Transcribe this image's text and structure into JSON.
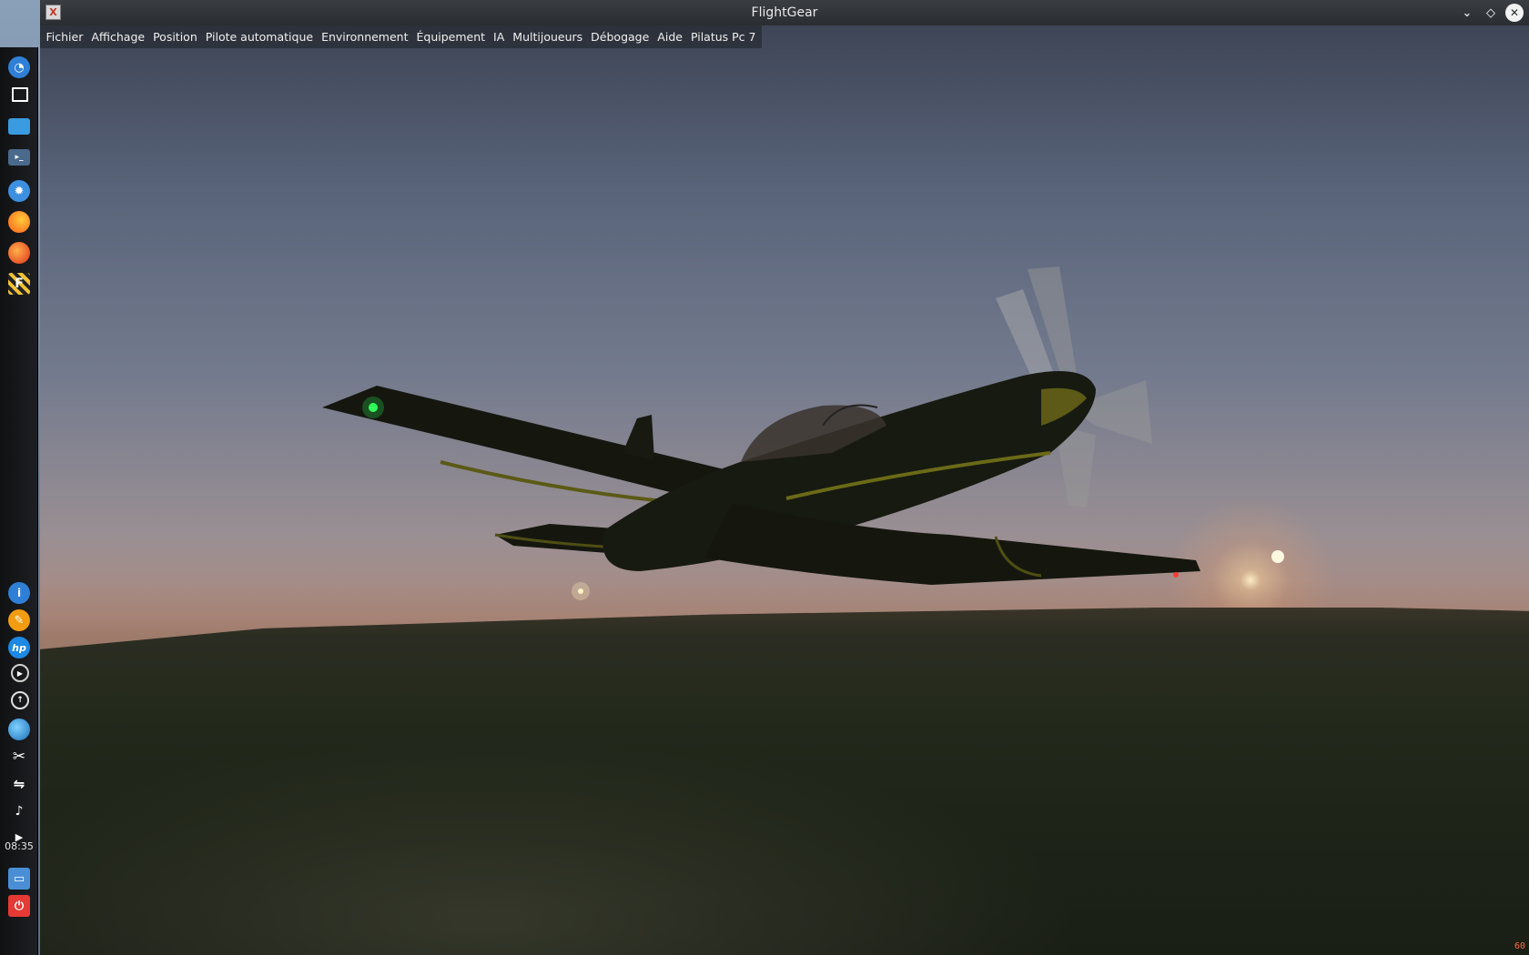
{
  "window": {
    "title": "FlightGear"
  },
  "menu": {
    "items": [
      "Fichier",
      "Affichage",
      "Position",
      "Pilote automatique",
      "Environnement",
      "Équipement",
      "IA",
      "Multijoueurs",
      "Débogage",
      "Aide",
      "Pilatus Pc 7"
    ]
  },
  "taskbar": {
    "clock": "08:35",
    "launchers": [
      {
        "icon": "kde-launcher-icon",
        "color": "#2f7fd6"
      },
      {
        "icon": "desktop-icon",
        "color": "#ffffff"
      },
      {
        "icon": "file-manager-icon",
        "color": "#3a9be0"
      },
      {
        "icon": "terminal-icon",
        "color": "#4a6a8c"
      },
      {
        "icon": "settings-icon",
        "color": "#3d8fe0"
      },
      {
        "icon": "firefox-icon",
        "color": "#ff7a1a"
      },
      {
        "icon": "firefox-alt-icon",
        "color": "#ff5a2a"
      },
      {
        "icon": "flightgear-icon",
        "color": "#f1c232"
      }
    ],
    "tray": [
      {
        "icon": "info-icon",
        "color": "#2f7fd6"
      },
      {
        "icon": "color-picker-icon",
        "color": "#f39c12"
      },
      {
        "icon": "hp-icon",
        "color": "#1e88e5"
      },
      {
        "icon": "media-player-icon",
        "color": "#d0d0d0"
      },
      {
        "icon": "updates-icon",
        "color": "#e0e0e0"
      },
      {
        "icon": "network-globe-icon",
        "color": "#3fa7e0"
      },
      {
        "icon": "scissors-icon",
        "color": "#e0e0e0"
      },
      {
        "icon": "usb-icon",
        "color": "#e0e0e0"
      },
      {
        "icon": "volume-icon",
        "color": "#e0e0e0"
      },
      {
        "icon": "expand-arrow-icon",
        "color": "#e0e0e0"
      },
      {
        "icon": "lock-screen-icon",
        "color": "#4a8fd6"
      },
      {
        "icon": "power-icon",
        "color": "#e53935"
      }
    ]
  },
  "hud": {
    "fps": "60"
  }
}
